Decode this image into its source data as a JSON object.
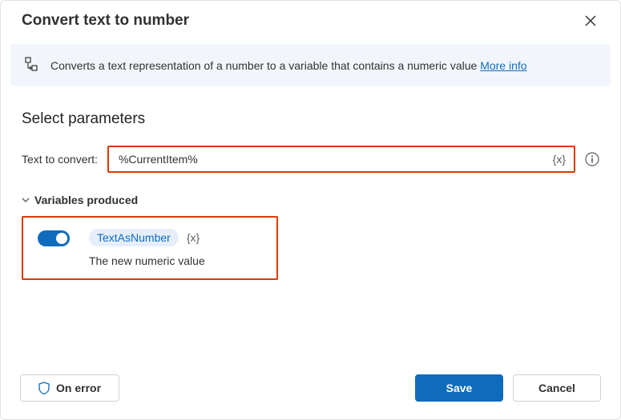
{
  "dialog": {
    "title": "Convert text to number"
  },
  "banner": {
    "text": "Converts a text representation of a number to a variable that contains a numeric value ",
    "link": "More info"
  },
  "parameters": {
    "heading": "Select parameters",
    "text_to_convert_label": "Text to convert:",
    "text_to_convert_value": "%CurrentItem%"
  },
  "variables_produced": {
    "heading": "Variables produced",
    "toggle_on": true,
    "variable_name": "TextAsNumber",
    "variable_suffix": "{x}",
    "description": "The new numeric value"
  },
  "buttons": {
    "on_error": "On error",
    "save": "Save",
    "cancel": "Cancel"
  }
}
